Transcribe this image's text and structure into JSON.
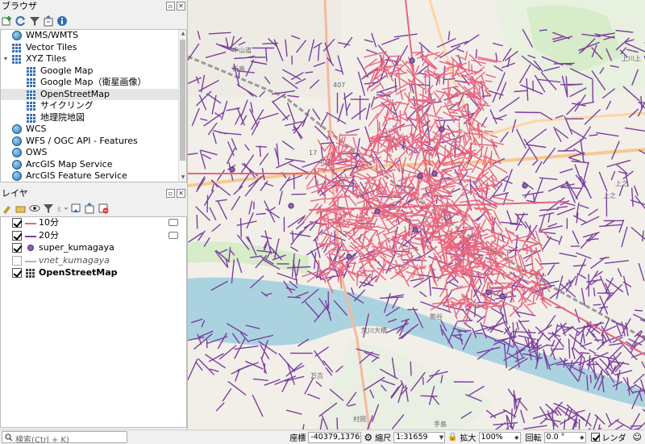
{
  "browser_panel": {
    "title": "ブラウザ",
    "items": [
      {
        "label": "WMS/WMTS",
        "icon": "globe-icon"
      },
      {
        "label": "Vector Tiles",
        "icon": "grid-icon"
      },
      {
        "label": "XYZ Tiles",
        "icon": "grid-icon",
        "expanded": true
      },
      {
        "label": "Google Map",
        "icon": "grid-icon"
      },
      {
        "label": "Google Map（衛星画像）",
        "icon": "grid-icon"
      },
      {
        "label": "OpenStreetMap",
        "icon": "grid-icon",
        "selected": true
      },
      {
        "label": "サイクリング",
        "icon": "grid-icon"
      },
      {
        "label": "地理院地図",
        "icon": "grid-icon"
      },
      {
        "label": "WCS",
        "icon": "globe-icon"
      },
      {
        "label": "WFS / OGC API - Features",
        "icon": "globe-icon"
      },
      {
        "label": "OWS",
        "icon": "globe-icon"
      },
      {
        "label": "ArcGIS Map Service",
        "icon": "globe-icon"
      },
      {
        "label": "ArcGIS Feature Service",
        "icon": "globe-icon"
      }
    ]
  },
  "layers_panel": {
    "title": "レイヤ",
    "layers": [
      {
        "label": "10分",
        "checked": true,
        "symbol": "line",
        "color": "#e8647f"
      },
      {
        "label": "20分",
        "checked": true,
        "symbol": "line",
        "color": "#7b3f9e"
      },
      {
        "label": "super_kumagaya",
        "checked": true,
        "symbol": "point",
        "color": "#8b62b4"
      },
      {
        "label": "vnet_kumagaya",
        "checked": false,
        "symbol": "line",
        "color": "#c9b27a"
      },
      {
        "label": "OpenStreetMap",
        "checked": true,
        "symbol": "raster",
        "color": "#444444"
      }
    ]
  },
  "map": {
    "labels": [
      "407",
      "17",
      "407",
      "熊谷",
      "荒川大橋",
      "万吉",
      "村岡",
      "新島",
      "上之",
      "上川上",
      "中山道",
      "上之",
      "手島"
    ],
    "colors": {
      "ten_min": "#e8647f",
      "twenty_min": "#7b3f9e",
      "water": "#aad3df",
      "green": "#d7ecc8",
      "rail": "#9a9a9a"
    }
  },
  "statusbar": {
    "search_placeholder": "検索(Ctrl + K)",
    "coord_label": "座標",
    "coord_value": "-40379,13766",
    "scale_label": "縮尺",
    "scale_value": "1:31659",
    "magnify_label": "拡大",
    "magnify_value": "100%",
    "rotation_label": "回転",
    "rotation_value": "0.0 °",
    "render_label": "レンダ"
  }
}
